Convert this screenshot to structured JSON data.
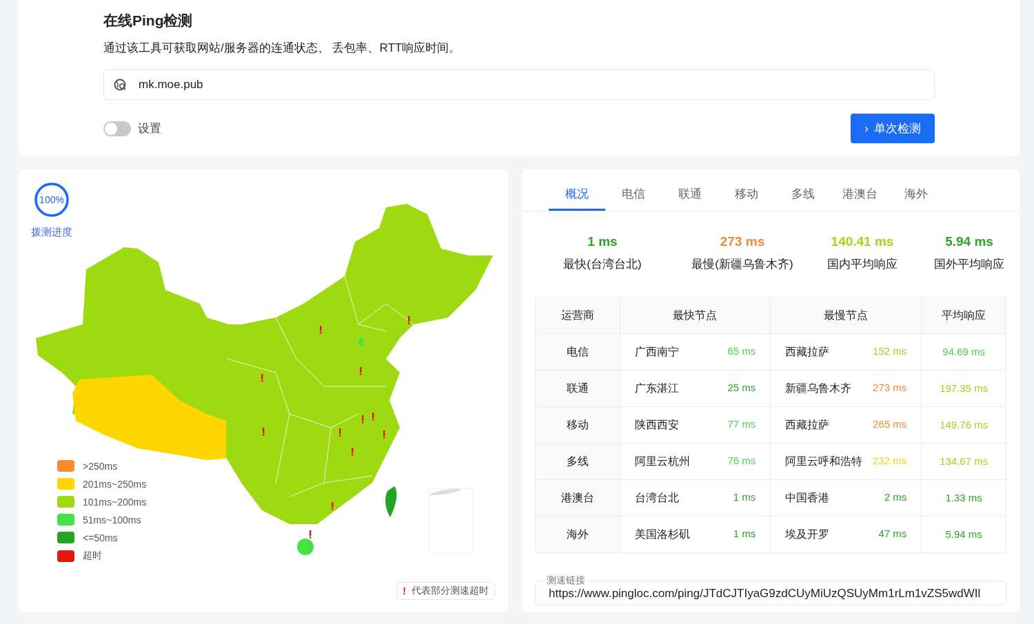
{
  "header": {
    "title": "在线Ping检测",
    "description": "通过该工具可获取网站/服务器的连通状态、 丢包率、RTT响应时间。"
  },
  "url_field": {
    "value": "mk.moe.pub"
  },
  "settings_toggle": {
    "label": "设置",
    "on": false
  },
  "check_button": {
    "icon": "›",
    "label": "单次检测"
  },
  "progress": {
    "text": "100%",
    "level": 1,
    "label": "拨测进度"
  },
  "legend": [
    {
      "label": ">250ms",
      "color": "#fb8c2e"
    },
    {
      "label": "201ms~250ms",
      "color": "#fed700"
    },
    {
      "label": "101ms~200ms",
      "color": "#9fd911"
    },
    {
      "label": "51ms~100ms",
      "color": "#47e046"
    },
    {
      "label": "<=50ms",
      "color": "#23a523"
    },
    {
      "label": "超时",
      "color": "#e8150f"
    }
  ],
  "timeout_note": {
    "icon": "!",
    "text": "代表部分测速超时"
  },
  "tabs": [
    {
      "label": "概况",
      "selected": true
    },
    {
      "label": "电信",
      "selected": false
    },
    {
      "label": "联通",
      "selected": false
    },
    {
      "label": "移动",
      "selected": false
    },
    {
      "label": "多线",
      "selected": false
    },
    {
      "label": "港澳台",
      "selected": false
    },
    {
      "label": "海外",
      "selected": false
    }
  ],
  "stats": [
    {
      "value": "1 ms",
      "label": "最快(台湾台北)",
      "color": "#2aa52a"
    },
    {
      "value": "273 ms",
      "label": "最慢(新疆乌鲁木齐)",
      "color": "#f08a35"
    },
    {
      "value": "140.41 ms",
      "label": "国内平均响应",
      "color": "#a2d616"
    },
    {
      "value": "5.94 ms",
      "label": "国外平均响应",
      "color": "#2aa52a"
    }
  ],
  "table": {
    "columns": [
      "运营商",
      "最快节点",
      "最慢节点",
      "平均响应"
    ],
    "rows": [
      {
        "isp": "电信",
        "fastest": {
          "node": "广西南宁",
          "ms": "65 ms",
          "color": "#4cd14c"
        },
        "slowest": {
          "node": "西藏拉萨",
          "ms": "152 ms",
          "color": "#a5d11a"
        },
        "average": {
          "ms": "94.69 ms",
          "color": "#4cd14c"
        }
      },
      {
        "isp": "联通",
        "fastest": {
          "node": "广东湛江",
          "ms": "25 ms",
          "color": "#2aa52a"
        },
        "slowest": {
          "node": "新疆乌鲁木齐",
          "ms": "273 ms",
          "color": "#f08a35"
        },
        "average": {
          "ms": "197.35 ms",
          "color": "#a5d11a"
        }
      },
      {
        "isp": "移动",
        "fastest": {
          "node": "陕西西安",
          "ms": "77 ms",
          "color": "#4cd14c"
        },
        "slowest": {
          "node": "西藏拉萨",
          "ms": "265 ms",
          "color": "#f08a35"
        },
        "average": {
          "ms": "149.76 ms",
          "color": "#a5d11a"
        }
      },
      {
        "isp": "多线",
        "fastest": {
          "node": "阿里云杭州",
          "ms": "76 ms",
          "color": "#4cd14c"
        },
        "slowest": {
          "node": "阿里云呼和浩特",
          "ms": "232 ms",
          "color": "#f5d10c"
        },
        "average": {
          "ms": "134.67 ms",
          "color": "#a5d11a"
        }
      },
      {
        "isp": "港澳台",
        "fastest": {
          "node": "台湾台北",
          "ms": "1 ms",
          "color": "#2aa52a"
        },
        "slowest": {
          "node": "中国香港",
          "ms": "2 ms",
          "color": "#2aa52a"
        },
        "average": {
          "ms": "1.33 ms",
          "color": "#2aa52a"
        }
      },
      {
        "isp": "海外",
        "fastest": {
          "node": "美国洛杉矶",
          "ms": "1 ms",
          "color": "#2aa52a"
        },
        "slowest": {
          "node": "埃及开罗",
          "ms": "47 ms",
          "color": "#2aa52a"
        },
        "average": {
          "ms": "5.94 ms",
          "color": "#2aa52a"
        }
      }
    ]
  },
  "link_field": {
    "label": "测速链接",
    "value": "https://www.pingloc.com/ping/JTdCJTIyaG9zdCUyMiUzQSUyMm1rLm1vZS5wdWIl"
  }
}
